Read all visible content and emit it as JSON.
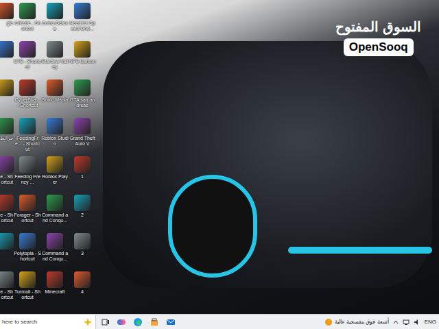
{
  "watermark": {
    "arabic": "السوق المفتوح",
    "latin": "OpenSooq"
  },
  "wallpaper": {
    "kind": "photo"
  },
  "desktop": {
    "columns": [
      {
        "kind": "partial",
        "icons": [
          {
            "label": "gle"
          },
          {
            "label": ""
          },
          {
            "label": ""
          },
          {
            "label": "خرائط"
          },
          {
            "label": "e - Shortcut"
          },
          {
            "label": "e - Shortcut"
          },
          {
            "label": ""
          },
          {
            "label": "e - Shortcut"
          }
        ]
      },
      {
        "kind": "full",
        "icons": [
          {
            "label": "Ghizzle - Shortcut"
          },
          {
            "label": "CT3 - Shortcut"
          },
          {
            "label": "CyberSha... - Shortcut"
          },
          {
            "label": "FeedingFre... - Shortcut"
          },
          {
            "label": "Feeding Frenzy ..."
          },
          {
            "label": "Forager - Shortcut"
          },
          {
            "label": "Polytopia - Shortcut"
          },
          {
            "label": "Turmoil - Shortcut"
          }
        ]
      },
      {
        "kind": "full",
        "icons": [
          {
            "label": "Zuma Deluxe"
          },
          {
            "label": "Stardew Valley"
          },
          {
            "label": "Sonic Mania"
          },
          {
            "label": "Roblox Studio"
          },
          {
            "label": "Roblox Player"
          },
          {
            "label": "Command and Conqu..."
          },
          {
            "label": "Command and Conqu..."
          },
          {
            "label": "Minecraft"
          }
        ]
      },
      {
        "kind": "full",
        "icons": [
          {
            "label": "Need for Speed Und..."
          },
          {
            "label": "NFS Carbon"
          },
          {
            "label": "GTA san andreas"
          },
          {
            "label": "Grand Theft Auto V"
          },
          {
            "label": "1"
          },
          {
            "label": "2"
          },
          {
            "label": "3"
          },
          {
            "label": "4"
          }
        ]
      }
    ]
  },
  "taskbar": {
    "search": {
      "placeholder": "here to search"
    },
    "weather": {
      "text": "أشعة فوق بنفسجية عالية"
    },
    "language": "ENG"
  }
}
